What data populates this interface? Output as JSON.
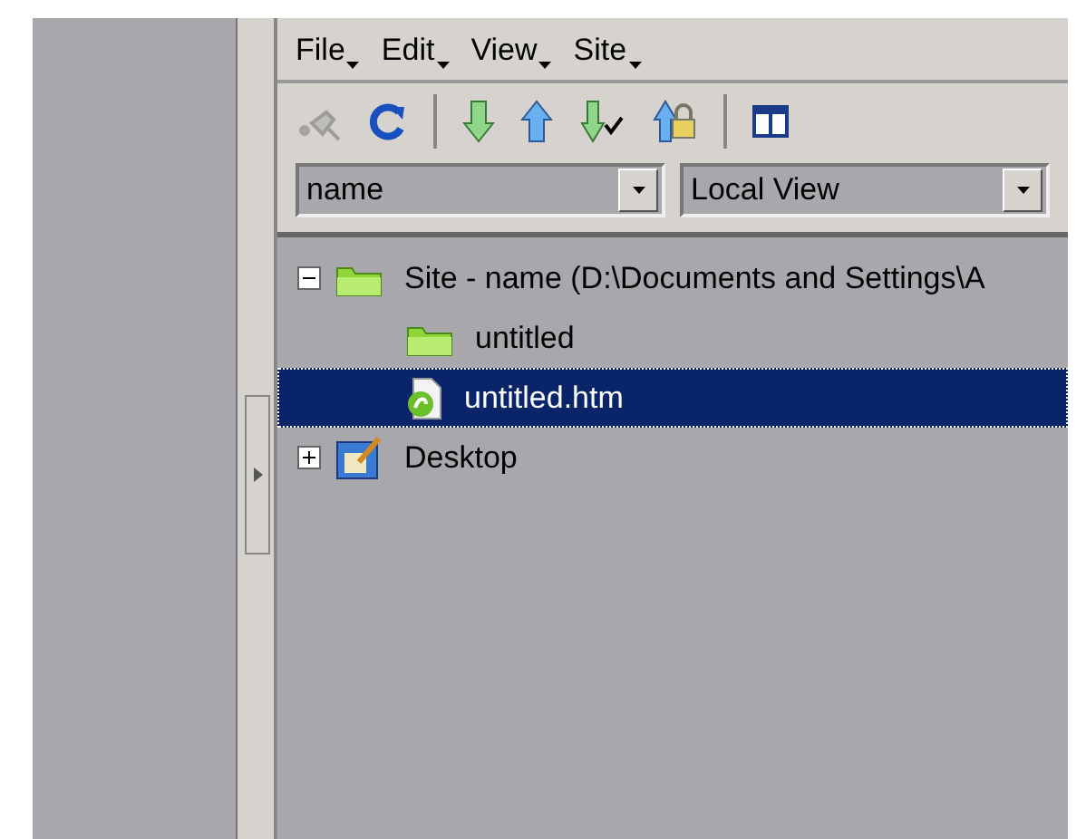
{
  "menu": [
    {
      "label": "File"
    },
    {
      "label": "Edit"
    },
    {
      "label": "View"
    },
    {
      "label": "Site"
    }
  ],
  "toolbar": [
    {
      "kind": "connect",
      "disabled": true
    },
    {
      "kind": "refresh",
      "disabled": false
    },
    {
      "kind": "separator"
    },
    {
      "kind": "get",
      "disabled": false
    },
    {
      "kind": "put",
      "disabled": false
    },
    {
      "kind": "checkin",
      "disabled": false
    },
    {
      "kind": "checkout",
      "disabled": false
    },
    {
      "kind": "separator"
    },
    {
      "kind": "expand",
      "disabled": false
    }
  ],
  "site_select": {
    "value": "name"
  },
  "view_select": {
    "value": "Local View"
  },
  "tree": [
    {
      "kind": "site",
      "label": "Site - name (D:\\Documents and Settings\\A",
      "expanded": true,
      "selected": false,
      "children": [
        {
          "kind": "folder",
          "label": "untitled",
          "selected": false
        },
        {
          "kind": "file",
          "label": "untitled.htm",
          "selected": true
        }
      ]
    },
    {
      "kind": "desktop",
      "label": "Desktop",
      "expanded": false,
      "selected": false
    }
  ]
}
